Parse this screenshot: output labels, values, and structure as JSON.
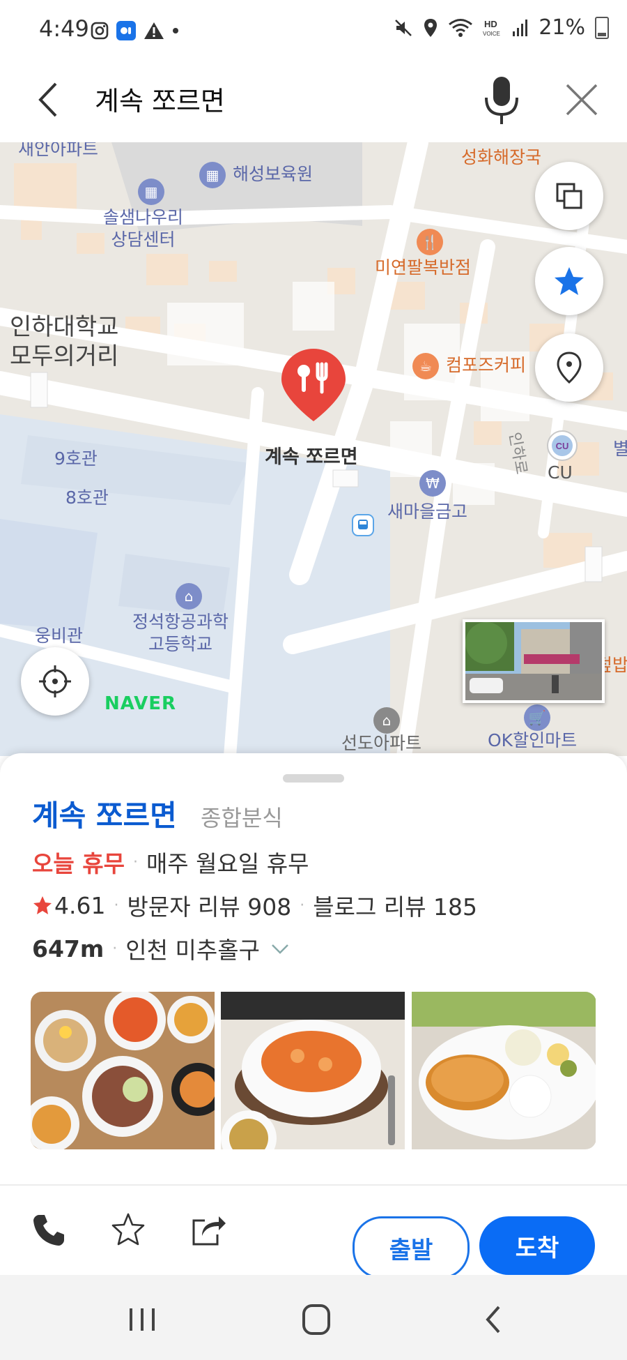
{
  "status_bar": {
    "time": "4:49",
    "battery": "21%"
  },
  "header": {
    "search_text": "계속 쪼르면"
  },
  "map": {
    "labels": {
      "apartment_top": "새안아파트",
      "daycare": "해성보육원",
      "counseling": "솔샘나우리\n상담센터",
      "restaurant_top": "성화해장국",
      "chinese": "미연팔복반점",
      "street": "인하대학교\n모두의거리",
      "cafe": "컴포즈커피",
      "selected_place": "계속 쪼르면",
      "building9": "9호관",
      "building8": "8호관",
      "bank": "새마을금고",
      "road": "인하로",
      "cu": "CU",
      "cu_badge": "CU",
      "school": "정석항공과학\n고등학교",
      "ungbi": "웅비관",
      "apartment_bottom": "선도아파트",
      "mart": "OK할인마트",
      "right_edge": "덮밥",
      "right_edge_top": "별",
      "naver": "NAVER"
    }
  },
  "place": {
    "name": "계속 쪼르면",
    "category": "종합분식",
    "status": "오늘 휴무",
    "holiday": "매주 월요일 휴무",
    "rating": "4.61",
    "visitor_reviews": "방문자 리뷰 908",
    "blog_reviews": "블로그 리뷰 185",
    "distance": "647m",
    "location": "인천 미추홀구"
  },
  "actions": {
    "depart": "출발",
    "arrive": "도착"
  },
  "colors": {
    "accent": "#0a6cf5",
    "name_blue": "#0b5bd0",
    "closed_red": "#e8453c",
    "pin_red": "#e8453c",
    "naver_green": "#19ce60"
  }
}
